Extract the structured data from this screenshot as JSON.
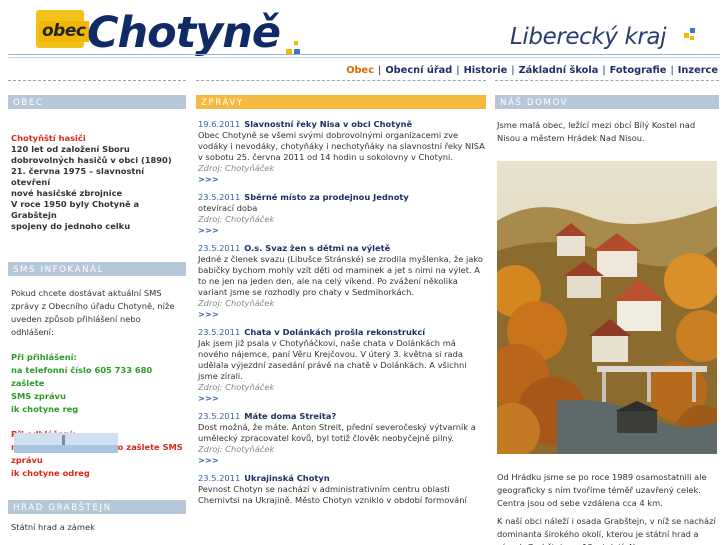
{
  "header": {
    "logo_prefix": "obec",
    "logo_name": "Chotyně",
    "region": "Liberecký kraj"
  },
  "nav": [
    {
      "label": "Obec",
      "active": true
    },
    {
      "label": "Obecní úřad"
    },
    {
      "label": "Historie"
    },
    {
      "label": "Základní škola"
    },
    {
      "label": "Fotografie"
    },
    {
      "label": "Inzerce"
    }
  ],
  "left": {
    "obec_heading": "OBEC",
    "hasici_title": "Chotyňští hasiči",
    "hasici_lines": [
      "120 let od založení Sboru",
      "dobrovolných hasičů v obci (1890)",
      "21. června 1975 – slavnostní otevření",
      "nové hasičské zbrojnice",
      "V roce 1950 byly Chotyně a Grabštejn",
      "spojeny do jednoho celku"
    ],
    "sms_heading": "SMS INFOKANÁL",
    "sms_intro": "Pokud chcete dostávat aktuální SMS zprávy z Obecního úřadu Chotyně, níže uveden způsob přihlášení nebo odhlášení:",
    "login_title": "Při přihlášení:",
    "login_lines": [
      "na telefonní číslo 605 733 680 zašlete",
      "SMS zprávu",
      "ik chotyne reg"
    ],
    "logout_title": "Při odhlášení:",
    "logout_lines": [
      "na stejné telefonní číslo zašlete SMS",
      "zprávu",
      "ik chotyne odreg"
    ],
    "hrad_heading": "HRAD GRABŠTEJN",
    "hrad_text": "Státní hrad a zámek"
  },
  "news_heading": "ZPRÁVY",
  "news": [
    {
      "date": "19.6.2011",
      "title": "Slavnostní řeky Nisa v obci Chotyně",
      "body": "Obec Chotyně se všemi svými dobrovolnými organizacemi zve vodáky i nevodáky, chotyňáky i nechotyňáky na slavnostní řeky NISA v sobotu 25. června 2011 od 14 hodin u sokolovny v Chotyni.",
      "source": "Zdroj: Chotyňáček",
      "more": ">>>"
    },
    {
      "date": "23.5.2011",
      "title": "Sběrné místo za prodejnou Jednoty",
      "body": "otevírací doba",
      "source": "Zdroj: Chotyňáček",
      "more": ">>>"
    },
    {
      "date": "23.5.2011",
      "title": "O.s. Svaz žen s dětmi na výletě",
      "body": "Jedné z členek svazu (Libušce Stránské) se zrodila myšlenka, že jako babičky bychom mohly vzít děti od maminek a jet s nimi na výlet. A to ne jen na jeden den, ale na celý víkend. Po zvážení několika variant jsme se rozhodly pro chaty v Sedmihorkách.",
      "source": "Zdroj: Chotyňáček",
      "more": ">>>"
    },
    {
      "date": "23.5.2011",
      "title": "Chata v Dolánkách prošla rekonstrukcí",
      "body": "Jak jsem již psala v Chotyňáčkovi, naše chata v Dolánkách má nového nájemce, paní Věru Krejčovou. V úterý 3. května si rada udělala výjezdní zasedání právě na chatě v Dolánkách. A všichni jsme zírali.",
      "source": "Zdroj: Chotyňáček",
      "more": ">>>"
    },
    {
      "date": "23.5.2011",
      "title": "Máte doma Streita?",
      "body": "Dost možná, že máte. Anton Streit, přední severočeský výtvarník a umělecký zpracovatel kovů, byl totiž člověk neobyčejně pilný.",
      "source": "Zdroj: Chotyňáček",
      "more": ">>>"
    },
    {
      "date": "23.5.2011",
      "title": "Ukrajinská Chotyn",
      "body": "Pevnost Chotyn se nachází v administrativním centru oblasti Chernivtsi na Ukrajině. Město Chotyn vzniklo v období formování",
      "source": "",
      "more": ""
    }
  ],
  "right": {
    "heading": "NÁŠ DOMOV",
    "intro": "Jsme malá obec, ležící mezi obcí Bílý Kostel nad Nisou a městem Hrádek Nad Nisou.",
    "text1": "Od Hrádku jsme se po roce 1989 osamostatnili ale geograficky s ním tvoříme téměř uzavřený celek. Centra jsou od sebe vzdálena cca 4 km.",
    "text2": "K naší obci náleží i osada Grabštejn, v níž se nachází dominanta širokého okolí, kterou je státní hrad a zámek Grabštejn ze 13. století. Na"
  },
  "colors": {
    "brand_blue": "#102a66",
    "nav_active": "#e06a00",
    "news_head": "#f5b93f",
    "side_head": "#b6c8d8",
    "red": "#d8291a",
    "green": "#2a9a2a"
  }
}
